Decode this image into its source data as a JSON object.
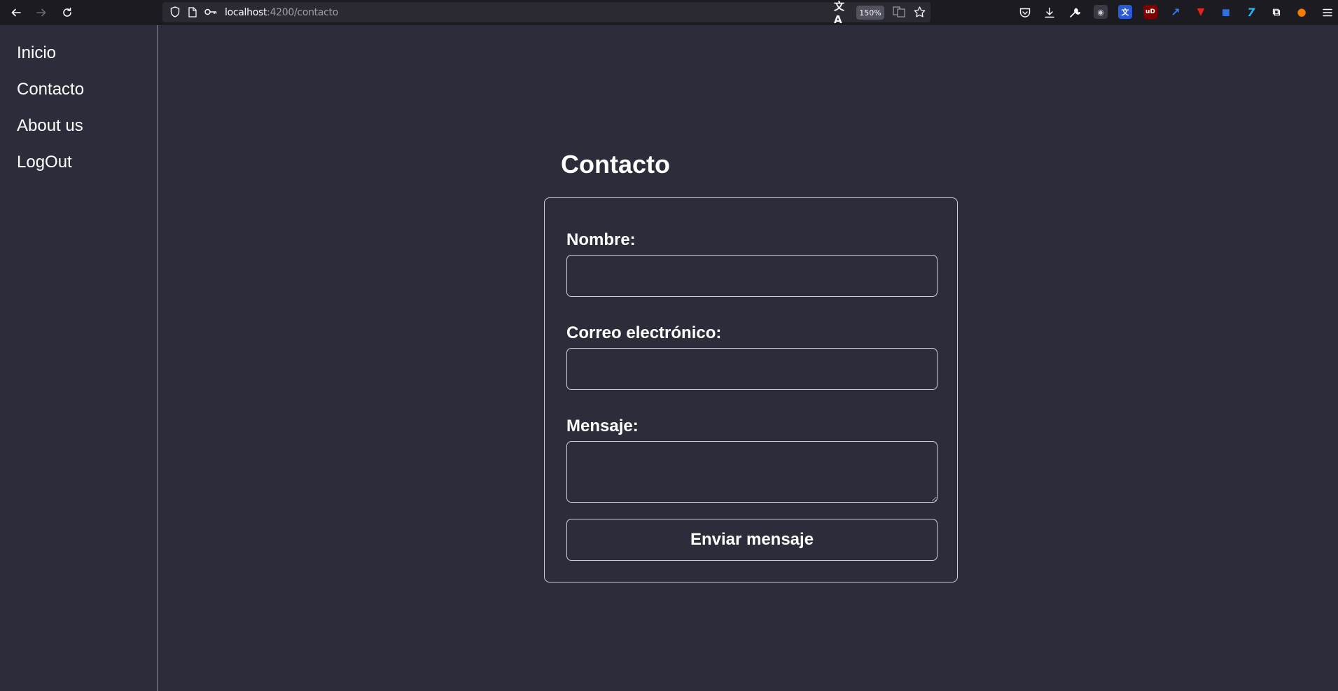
{
  "browser": {
    "url_host": "localhost",
    "url_path": ":4200/contacto",
    "zoom": "150%",
    "icons": {
      "back": "back-arrow-icon",
      "forward": "forward-arrow-icon",
      "reload": "reload-icon",
      "shield": "tracking-protection-shield-icon",
      "page": "page-info-icon",
      "key": "key-icon",
      "translate": "translate-icon",
      "reader": "reader-view-icon",
      "bookmark": "bookmark-star-icon",
      "pocket": "pocket-icon",
      "downloads": "downloads-icon",
      "tools": "wrench-icon",
      "menu": "hamburger-menu-icon"
    },
    "extensions": [
      {
        "name": "extension-globe-icon",
        "glyph": "◉",
        "bg": "#3a3a44",
        "color": "#c8c8d0"
      },
      {
        "name": "extension-translate-icon",
        "glyph": "文",
        "bg": "#2a5bd7",
        "color": "#ffffff"
      },
      {
        "name": "extension-ublock-icon",
        "glyph": "uD",
        "bg": "#800000",
        "color": "#ffffff"
      },
      {
        "name": "extension-arrow-icon",
        "glyph": "↗",
        "bg": "#1c1b22",
        "color": "#2f7ff0"
      },
      {
        "name": "extension-youtube-icon",
        "glyph": "▼",
        "bg": "#1c1b22",
        "color": "#e1251b"
      },
      {
        "name": "extension-shield-icon",
        "glyph": "◼",
        "bg": "#1c1b22",
        "color": "#2f6fe0"
      },
      {
        "name": "extension-7tv-icon",
        "glyph": "7",
        "bg": "#1c1b22",
        "color": "#29b6f6"
      },
      {
        "name": "extensions-puzzle-icon",
        "glyph": "⧉",
        "bg": "#1c1b22",
        "color": "#fbfbfe"
      },
      {
        "name": "profile-avatar-icon",
        "glyph": "●",
        "bg": "#1c1b22",
        "color": "#f57c00"
      }
    ]
  },
  "sidebar": {
    "items": [
      {
        "label": "Inicio"
      },
      {
        "label": "Contacto"
      },
      {
        "label": "About us"
      },
      {
        "label": "LogOut"
      }
    ]
  },
  "main": {
    "title": "Contacto",
    "form": {
      "name_label": "Nombre:",
      "name_value": "",
      "email_label": "Correo electrónico:",
      "email_value": "",
      "message_label": "Mensaje:",
      "message_value": "",
      "submit_label": "Enviar mensaje"
    }
  },
  "colors": {
    "background": "#2b2d3b",
    "border": "#cfd0d6",
    "text": "#ffffff",
    "toolbar": "#1c1b22"
  }
}
